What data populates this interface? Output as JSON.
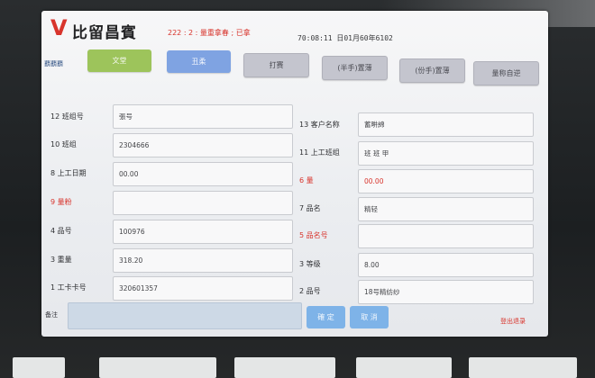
{
  "colors": {
    "red": "#d8342c",
    "green": "#9dc45b",
    "blue": "#7fa3e2",
    "gray": "#c4c5ce"
  },
  "header": {
    "logo": "V",
    "title": "比留昌賓",
    "status": "222 : 2 : 量重拿春 ; 已拿",
    "datetime": "70:08:11 日01月60年6102"
  },
  "toolbar": {
    "side_label": "覇覇覇",
    "buttons": [
      {
        "label": "文堂"
      },
      {
        "label": "丑柔"
      },
      {
        "label": "打赛"
      },
      {
        "label": "(半手)置薄"
      },
      {
        "label": "(份手)置薄"
      },
      {
        "label": "量称自逆"
      }
    ]
  },
  "form": {
    "left": [
      {
        "label": "12 班组号",
        "value": "張号",
        "highlight": false
      },
      {
        "label": "10 班组",
        "value": "2304666",
        "highlight": false
      },
      {
        "label": "8 上工日期",
        "value": "00.00",
        "highlight": false
      },
      {
        "label": "9 量粉",
        "value": "",
        "highlight": true
      },
      {
        "label": "4 品号",
        "value": "100976",
        "highlight": false
      },
      {
        "label": "3 重量",
        "value": "318.20",
        "highlight": false
      },
      {
        "label": "1 工卡卡号",
        "value": "320601357",
        "highlight": false
      }
    ],
    "right": [
      {
        "label": "13 客户名称",
        "value": "蓄畊綿",
        "highlight": false
      },
      {
        "label": "11 上工班组",
        "value": "班 班 甲",
        "highlight": false
      },
      {
        "label": "6 量",
        "value": "00.00",
        "highlight": true
      },
      {
        "label": "7 品名",
        "value": "精轻",
        "highlight": false
      },
      {
        "label": "5 品名号",
        "value": "",
        "highlight": true
      },
      {
        "label": "3 等级",
        "value": "8.00",
        "highlight": false
      },
      {
        "label": "2 品号",
        "value": "18号精纺纱",
        "highlight": false
      }
    ]
  },
  "footer": {
    "remark_label": "备注",
    "remark_value": "",
    "confirm": "確 定",
    "cancel": "取 消",
    "logout": "登出退录"
  }
}
